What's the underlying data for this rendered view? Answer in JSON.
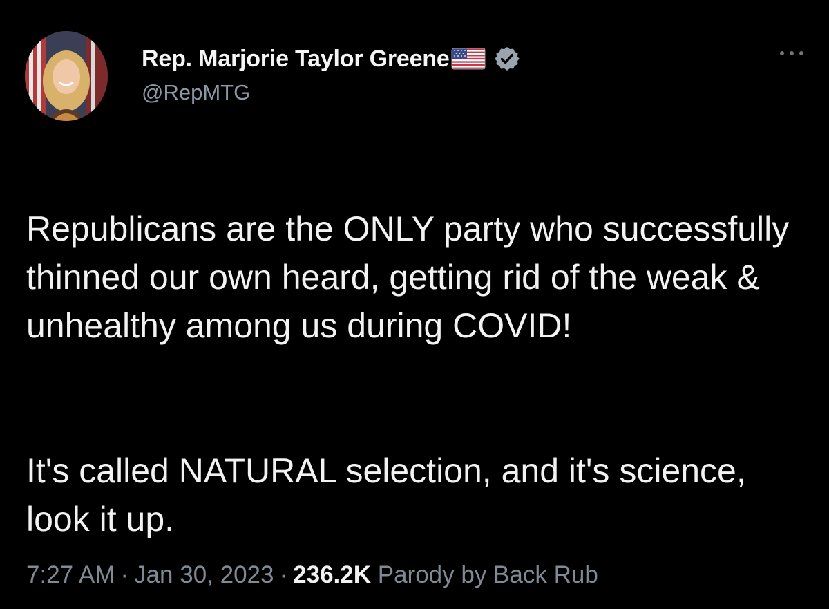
{
  "author": {
    "display_name": "Rep. Marjorie Taylor Greene",
    "handle": "@RepMTG",
    "name_emoji_icon": "us-flag-icon",
    "verification_icon": "verified-badge-icon",
    "verified_color": "#9aa4ae"
  },
  "actions": {
    "more_icon": "more-options-icon"
  },
  "tweet": {
    "paragraphs": [
      "Republicans are the ONLY party who successfully thinned our own heard, getting rid of the weak & unhealthy among us during COVID!",
      "It's called NATURAL selection, and it's science, look it up."
    ]
  },
  "meta": {
    "time": "7:27 AM",
    "separator": "·",
    "date": "Jan 30, 2023",
    "views": "236.2K",
    "views_suffix": "Parody by Back Rub"
  },
  "colors": {
    "background": "#000000",
    "primary_text": "#f2f2f2",
    "secondary_text": "#8b98a5"
  }
}
